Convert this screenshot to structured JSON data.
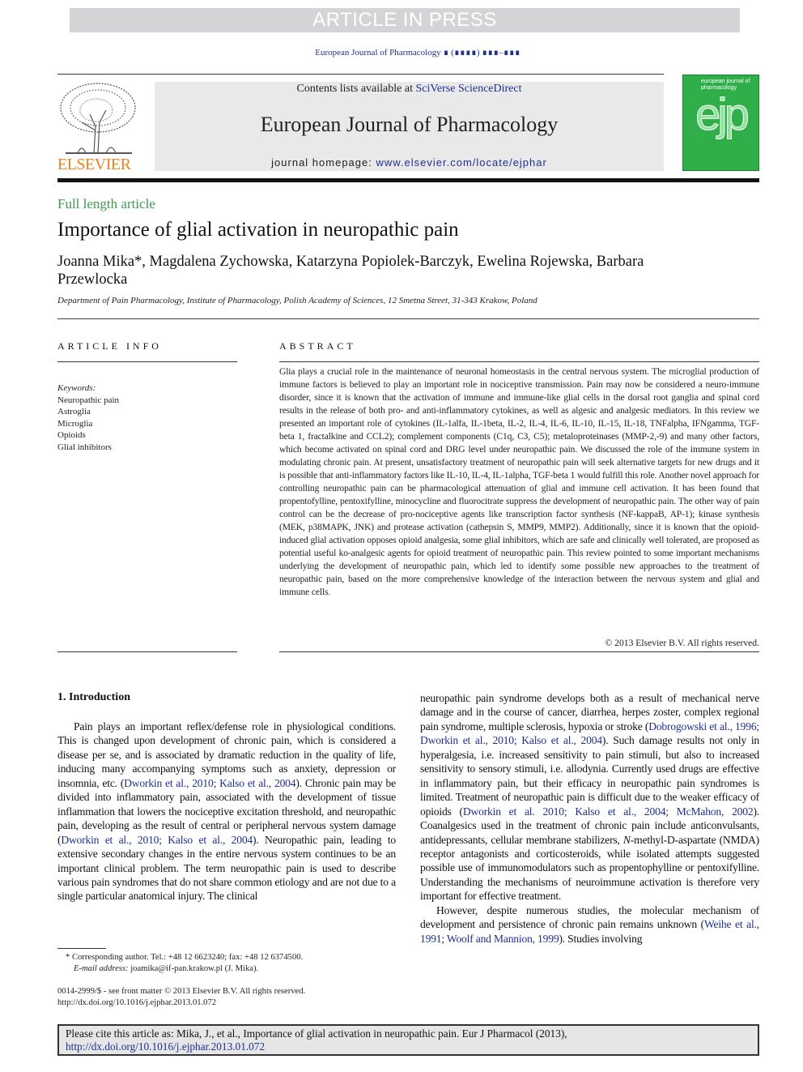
{
  "banner": "ARTICLE IN PRESS",
  "journal_ref": "European Journal of Pharmacology ∎ (∎∎∎∎) ∎∎∎–∎∎∎",
  "publisher_logo": "ELSEVIER",
  "masthead": {
    "contents_prefix": "Contents lists available at ",
    "contents_link": "SciVerse ScienceDirect",
    "journal_title": "European Journal of Pharmacology",
    "homepage_prefix": "journal homepage: ",
    "homepage_link": "www.elsevier.com/locate/ejphar"
  },
  "cover": {
    "title": "european journal of pharmacology",
    "logo": "ejp"
  },
  "article_type": "Full length article",
  "title": "Importance of glial activation in neuropathic pain",
  "authors": "Joanna Mika*, Magdalena Zychowska, Katarzyna Popiolek-Barczyk, Ewelina Rojewska, Barbara Przewlocka",
  "affiliation": "Department of Pain Pharmacology, Institute of Pharmacology, Polish Academy of Sciences, 12 Smetna Street, 31-343 Krakow, Poland",
  "article_info": {
    "heading": "ARTICLE INFO",
    "keywords_label": "Keywords:",
    "keywords": [
      "Neuropathic pain",
      "Astroglia",
      "Microglia",
      "Opioids",
      "Glial inhibitors"
    ]
  },
  "abstract": {
    "heading": "ABSTRACT",
    "text": "Glia plays a crucial role in the maintenance of neuronal homeostasis in the central nervous system. The microglial production of immune factors is believed to play an important role in nociceptive transmission. Pain may now be considered a neuro-immune disorder, since it is known that the activation of immune and immune-like glial cells in the dorsal root ganglia and spinal cord results in the release of both pro- and anti-inflammatory cytokines, as well as algesic and analgesic mediators. In this review we presented an important role of cytokines (IL-1alfa, IL-1beta, IL-2, IL-4, IL-6, IL-10, IL-15, IL-18, TNFalpha, IFNgamma, TGF-beta 1, fractalkine and CCL2); complement components (C1q, C3, C5); metaloproteinases (MMP-2,-9) and many other factors, which become activated on spinal cord and DRG level under neuropathic pain. We discussed the role of the immune system in modulating chronic pain. At present, unsatisfactory treatment of neuropathic pain will seek alternative targets for new drugs and it is possible that anti-inflammatory factors like IL-10, IL-4, IL-1alpha, TGF-beta 1 would fulfill this role. Another novel approach for controlling neuropathic pain can be pharmacological attenuation of glial and immune cell activation. It has been found that propentofylline, pentoxifylline, minocycline and fluorocitrate suppress the development of neuropathic pain. The other way of pain control can be the decrease of pro-nociceptive agents like transcription factor synthesis (NF-kappaB, AP-1); kinase synthesis (MEK, p38MAPK, JNK) and protease activation (cathepsin S, MMP9, MMP2). Additionally, since it is known that the opioid-induced glial activation opposes opioid analgesia, some glial inhibitors, which are safe and clinically well tolerated, are proposed as potential useful ko-analgesic agents for opioid treatment of neuropathic pain. This review pointed to some important mechanisms underlying the development of neuropathic pain, which led to identify some possible new approaches to the treatment of neuropathic pain, based on the more comprehensive knowledge of the interaction between the nervous system and glial and immune cells.",
    "copyright": "© 2013 Elsevier B.V. All rights reserved."
  },
  "intro": {
    "heading": "1.  Introduction",
    "left": [
      [
        {
          "t": "Pain plays an important reflex/defense role in physiological conditions. This is changed upon development of chronic pain, which is considered a disease per se, and is associated by dramatic reduction in the quality of life, inducing many accompanying symptoms such as anxiety, depression or insomnia, etc. ("
        },
        {
          "t": "Dworkin et al., 2010; Kalso et al., 2004",
          "l": 1
        },
        {
          "t": "). Chronic pain may be divided into inflammatory pain, associated with the development of tissue inflammation that lowers the nociceptive excitation threshold, and neuropathic pain, developing as the result of central or peripheral nervous system damage ("
        },
        {
          "t": "Dworkin et al., 2010; Kalso et al., 2004",
          "l": 1
        },
        {
          "t": "). Neuropathic pain, leading to extensive secondary changes in the entire nervous system continues to be an important clinical problem. The term neuropathic pain is used to describe various pain syndromes that do not share common etiology and are not due to a single particular anatomical injury. The clinical"
        }
      ]
    ],
    "right": [
      [
        {
          "t": "neuropathic pain syndrome develops both as a result of mechanical nerve damage and in the course of cancer, diarrhea, herpes zoster, complex regional pain syndrome, multiple sclerosis, hypoxia or stroke ("
        },
        {
          "t": "Dobrogowski et al., 1996; Dworkin et al., 2010; Kalso et al., 2004",
          "l": 1
        },
        {
          "t": "). Such damage results not only in hyperalgesia, i.e. increased sensitivity to pain stimuli, but also to increased sensitivity to sensory stimuli, i.e. allodynia. Currently used drugs are effective in inflammatory pain, but their efficacy in neuropathic pain syndromes is limited. Treatment of neuropathic pain is difficult due to the weaker efficacy of opioids ("
        },
        {
          "t": "Dworkin et al. 2010; Kalso et al., 2004; McMahon, 2002",
          "l": 1
        },
        {
          "t": "). Coanalgesics used in the treatment of chronic pain include anticonvulsants, antidepressants, cellular membrane stabilizers, "
        },
        {
          "t": "N",
          "i": 1
        },
        {
          "t": "-methyl-D-aspartate (NMDA) receptor antagonists and corticosteroids, while isolated attempts suggested possible use of immunomodulators such as propentophylline or pentoxifylline. Understanding the mechanisms of neuroimmune activation is therefore very important for effective treatment."
        }
      ],
      [
        {
          "t": "However, despite numerous studies, the molecular mechanism of development and persistence of chronic pain remains unknown ("
        },
        {
          "t": "Weihe et al., 1991; Woolf and Mannion, 1999",
          "l": 1
        },
        {
          "t": "). Studies involving"
        }
      ]
    ]
  },
  "footnote": {
    "corresponding": "* Corresponding author. Tel.: +48 12 6623240; fax: +48 12 6374500.",
    "email_label": "E-mail address:",
    "email": " joamika@if-pan.krakow.pl (J. Mika)."
  },
  "front_matter": {
    "issn": "0014-2999/$ - see front matter © 2013 Elsevier B.V. All rights reserved.",
    "doi": "http://dx.doi.org/10.1016/j.ejphar.2013.01.072"
  },
  "citation": {
    "text": "Please cite this article as: Mika, J., et al., Importance of glial activation in neuropathic pain. Eur J Pharmacol (2013), ",
    "link": "http://dx.doi.org/10.1016/j.ejphar.2013.01.072"
  },
  "colors": {
    "link": "#1f2f8f",
    "article_type": "#3d9a4e",
    "elsevier": "#f07f1e",
    "cover": "#2fae4a"
  }
}
